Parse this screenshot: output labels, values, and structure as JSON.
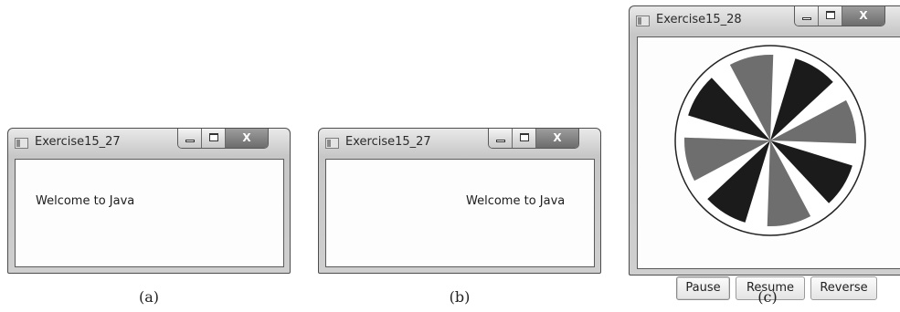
{
  "window_a": {
    "title": "Exercise15_27",
    "message": "Welcome to Java",
    "close_label": "X",
    "caption": "(a)"
  },
  "window_b": {
    "title": "Exercise15_27",
    "message": "Welcome to Java",
    "close_label": "X",
    "caption": "(b)"
  },
  "window_c": {
    "title": "Exercise15_28",
    "close_label": "X",
    "caption": "(c)",
    "buttons": {
      "pause": "Pause",
      "resume": "Resume",
      "reverse": "Reverse"
    },
    "fan": {
      "blade_colors": [
        "#1b1b1b",
        "#6e6e6e"
      ],
      "background": "#ffffff",
      "outline": "#222222",
      "blade_count": 8
    }
  }
}
